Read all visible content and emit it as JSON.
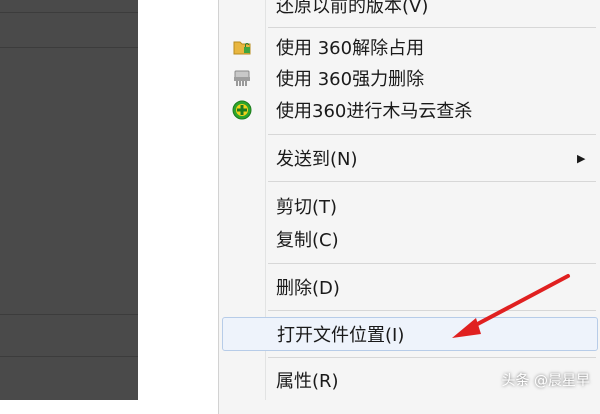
{
  "menu": {
    "items": [
      {
        "label": "还原以前的版本(V)",
        "icon": null
      },
      {
        "label": "使用 360解除占用",
        "icon": "folder-unlock-icon"
      },
      {
        "label": "使用 360强力删除",
        "icon": "shredder-icon"
      },
      {
        "label": "使用360进行木马云查杀",
        "icon": "shield-scan-icon"
      },
      {
        "label": "发送到(N)",
        "icon": null,
        "submenu": true
      },
      {
        "label": "剪切(T)",
        "icon": null
      },
      {
        "label": "复制(C)",
        "icon": null
      },
      {
        "label": "删除(D)",
        "icon": null
      },
      {
        "label": "打开文件位置(I)",
        "icon": null,
        "highlighted": true
      },
      {
        "label": "属性(R)",
        "icon": null
      }
    ],
    "submenu_arrow": "▶"
  },
  "annotation": {
    "arrow_color": "#e02020"
  },
  "watermark": {
    "text": "头条 @晨星早"
  },
  "colors": {
    "menu_bg": "#f5f5f5",
    "highlight_bg": "#eef3fb",
    "highlight_border": "#b7cce8",
    "left_panel": "#4a4a4a"
  }
}
